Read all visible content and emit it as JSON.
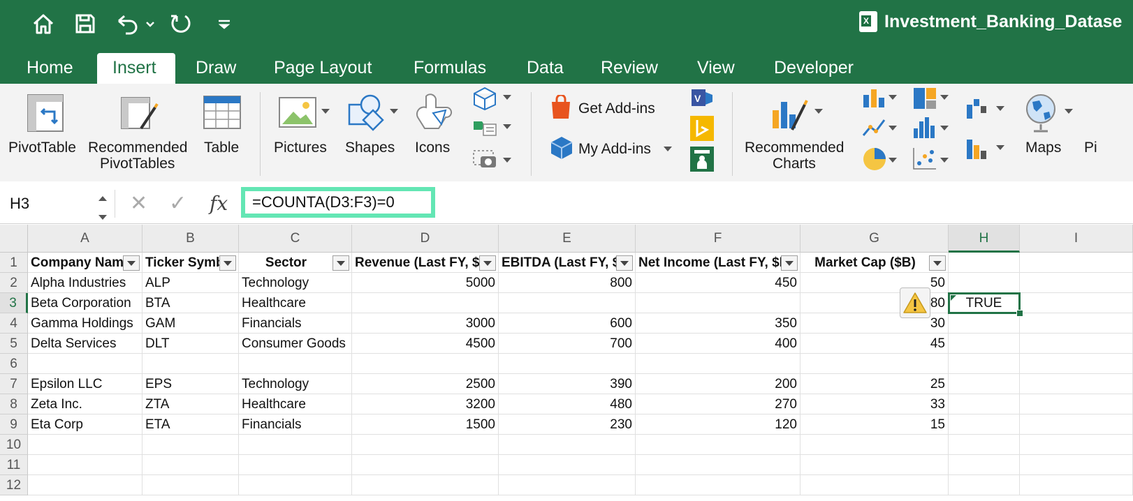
{
  "window": {
    "title": "Investment_Banking_Datase"
  },
  "quick_access": {
    "home_icon": "home-icon",
    "save_icon": "save-icon",
    "undo_icon": "undo-icon",
    "redo_icon": "redo-icon",
    "customize_icon": "customize-toolbar-icon"
  },
  "tabs": [
    {
      "label": "Home"
    },
    {
      "label": "Insert",
      "active": true
    },
    {
      "label": "Draw"
    },
    {
      "label": "Page Layout"
    },
    {
      "label": "Formulas"
    },
    {
      "label": "Data"
    },
    {
      "label": "Review"
    },
    {
      "label": "View"
    },
    {
      "label": "Developer"
    }
  ],
  "ribbon": {
    "pivottable": "PivotTable",
    "recommended_pivottables_1": "Recommended",
    "recommended_pivottables_2": "PivotTables",
    "table": "Table",
    "pictures": "Pictures",
    "shapes": "Shapes",
    "icons": "Icons",
    "get_addins": "Get Add-ins",
    "my_addins": "My Add-ins",
    "recommended_charts_1": "Recommended",
    "recommended_charts_2": "Charts",
    "maps": "Maps",
    "pi_partial": "Pi"
  },
  "formula_bar": {
    "name_box": "H3",
    "cancel_glyph": "✕",
    "enter_glyph": "✓",
    "fx_label": "fx",
    "formula": "=COUNTA(D3:F3)=0"
  },
  "sheet": {
    "columns": [
      "A",
      "B",
      "C",
      "D",
      "E",
      "F",
      "G",
      "H",
      "I"
    ],
    "rows": [
      "1",
      "2",
      "3",
      "4",
      "5",
      "6",
      "7",
      "8",
      "9",
      "10",
      "11",
      "12"
    ],
    "headers": [
      "Company Nam",
      "Ticker Symb",
      "Sector",
      "Revenue (Last FY, $I",
      "EBITDA (Last FY, $I",
      "Net Income (Last FY, $I",
      "Market Cap ($B)"
    ],
    "data": [
      [
        "Alpha Industries",
        "ALP",
        "Technology",
        "5000",
        "800",
        "450",
        "50"
      ],
      [
        "Beta Corporation",
        "BTA",
        "Healthcare",
        "",
        "",
        "",
        "80"
      ],
      [
        "Gamma Holdings",
        "GAM",
        "Financials",
        "3000",
        "600",
        "350",
        "30"
      ],
      [
        "Delta Services",
        "DLT",
        "Consumer Goods",
        "4500",
        "700",
        "400",
        "45"
      ],
      [
        "",
        "",
        "",
        "",
        "",
        "",
        ""
      ],
      [
        "Epsilon LLC",
        "EPS",
        "Technology",
        "2500",
        "390",
        "200",
        "25"
      ],
      [
        "Zeta Inc.",
        "ZTA",
        "Healthcare",
        "3200",
        "480",
        "270",
        "33"
      ],
      [
        "Eta Corp",
        "ETA",
        "Financials",
        "1500",
        "230",
        "120",
        "15"
      ]
    ],
    "h3_value": "TRUE",
    "selected_cell": "H3"
  },
  "colors": {
    "excel_green": "#217346",
    "highlight": "#63e6b4"
  }
}
